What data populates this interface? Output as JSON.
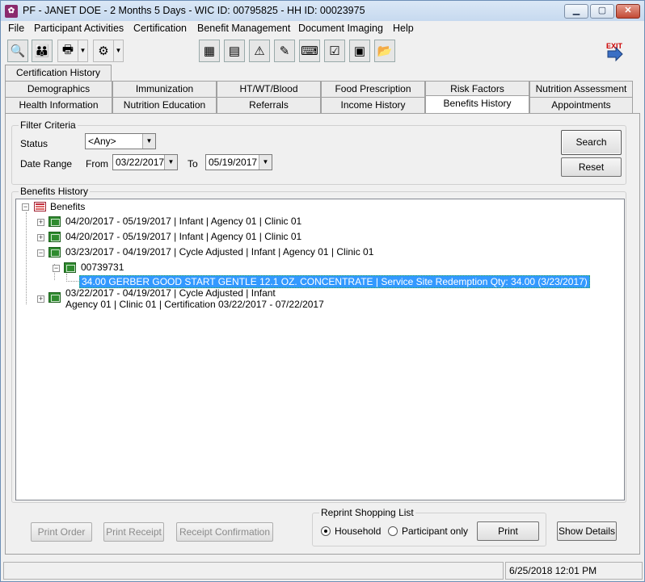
{
  "window": {
    "title": "PF - JANET DOE - 2 Months 5 Days - WIC ID: 00795825 - HH ID: 00023975"
  },
  "menu": {
    "items": [
      "File",
      "Participant Activities",
      "Certification",
      "Benefit Management",
      "Document Imaging",
      "Help"
    ]
  },
  "tabs": {
    "row0": [
      "Certification History"
    ],
    "row1": [
      "Demographics",
      "Immunization",
      "HT/WT/Blood",
      "Food Prescription",
      "Risk Factors",
      "Nutrition Assessment"
    ],
    "row2": [
      "Health Information",
      "Nutrition Education",
      "Referrals",
      "Income History",
      "Benefits History",
      "Appointments"
    ],
    "active": "Benefits History"
  },
  "filter": {
    "legend": "Filter Criteria",
    "status_label": "Status",
    "status_value": "<Any>",
    "date_range_label": "Date Range",
    "from_label": "From",
    "from_value": "03/22/2017",
    "to_label": "To",
    "to_value": "05/19/2017",
    "search_label": "Search",
    "reset_label": "Reset"
  },
  "benefits_history": {
    "legend": "Benefits History",
    "root_label": "Benefits",
    "nodes": [
      "04/20/2017 - 05/19/2017  |  Infant  |  Agency 01  |  Clinic 01",
      "04/20/2017 - 05/19/2017  |  Infant  |  Agency 01  |  Clinic 01",
      "03/23/2017 - 04/19/2017  |  Cycle Adjusted  |  Infant  |  Agency 01  |  Clinic 01"
    ],
    "sub_node": "00739731",
    "selected_item": "34.00 GERBER GOOD START GENTLE 12.1 OZ. CONCENTRATE | Service Site Redemption Qty: 34.00 (3/23/2017)",
    "last_node_line1": "03/22/2017 - 04/19/2017  |  Cycle Adjusted  |  Infant",
    "last_node_line2": "Agency 01  |  Clinic 01  |  Certification 03/22/2017 - 07/22/2017"
  },
  "bottom": {
    "print_order": "Print Order",
    "print_receipt": "Print Receipt",
    "receipt_confirmation": "Receipt Confirmation",
    "reprint_legend": "Reprint Shopping List",
    "household": "Household",
    "participant_only": "Participant only",
    "print": "Print",
    "show_details": "Show Details"
  },
  "status": {
    "datetime": "6/25/2018  12:01 PM"
  },
  "icons": [
    "search-icon",
    "family-icon",
    "printer-icon",
    "dropdown-icon",
    "tools-icon",
    "calculator-icon",
    "calendar-icon",
    "warning-icon",
    "note-icon",
    "keyboard-icon",
    "checklist-icon",
    "document-icon",
    "folder-icon",
    "exit-icon"
  ]
}
